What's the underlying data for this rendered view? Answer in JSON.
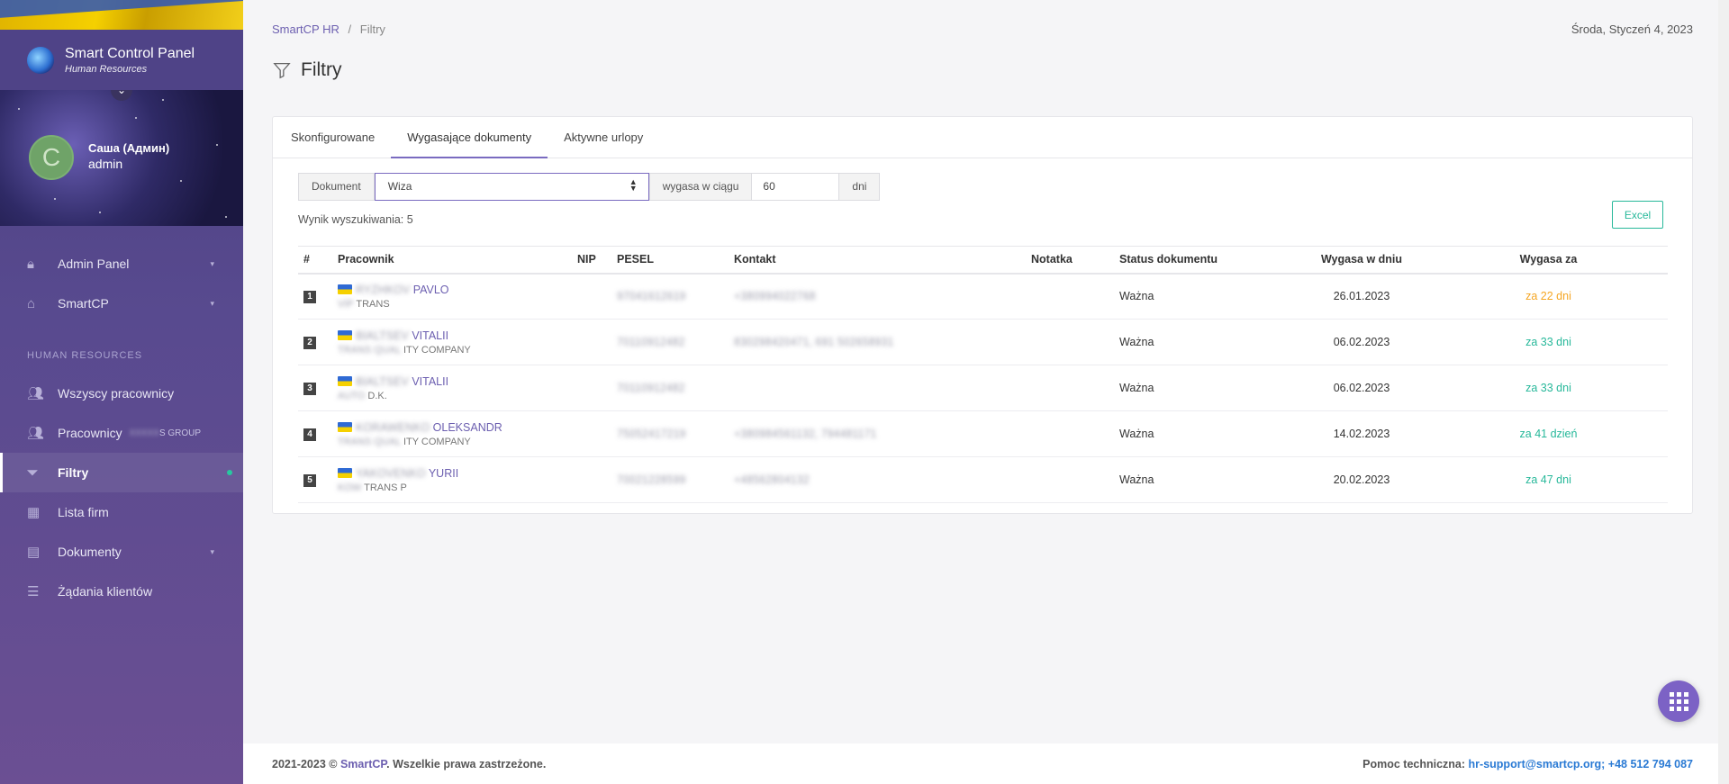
{
  "sidebar": {
    "brand_title": "Smart Control Panel",
    "brand_subtitle": "Human Resources",
    "user_initial": "С",
    "user_name": "Саша (Админ)",
    "user_role": "admin",
    "items": [
      {
        "label": "Admin Panel",
        "icon": "lock-icon",
        "has_chevron": true
      },
      {
        "label": "SmartCP",
        "icon": "home-icon",
        "has_chevron": true
      }
    ],
    "section_label": "HUMAN RESOURCES",
    "hr_items": [
      {
        "label": "Wszyscy pracownicy",
        "icon": "users-icon"
      },
      {
        "label": "Pracownicy",
        "suffix": "S GROUP",
        "icon": "users-icon"
      },
      {
        "label": "Filtry",
        "icon": "filter-icon",
        "active": true
      },
      {
        "label": "Lista firm",
        "icon": "building-icon"
      },
      {
        "label": "Dokumenty",
        "icon": "document-icon",
        "has_chevron": true
      },
      {
        "label": "Żądania klientów",
        "icon": "list-icon"
      }
    ]
  },
  "breadcrumb": {
    "root": "SmartCP HR",
    "separator": "/",
    "current": "Filtry"
  },
  "date": "Środa, Styczeń 4, 2023",
  "page_title": "Filtry",
  "tabs": [
    {
      "label": "Skonfigurowane",
      "active": false
    },
    {
      "label": "Wygasające dokumenty",
      "active": true
    },
    {
      "label": "Aktywne urlopy",
      "active": false
    }
  ],
  "filter": {
    "document_label": "Dokument",
    "document_value": "Wiza",
    "expires_label": "wygasa w ciągu",
    "days_value": "60",
    "days_unit": "dni"
  },
  "result_text": "Wynik wyszukiwania: 5",
  "excel_label": "Excel",
  "table": {
    "headers": [
      "#",
      "Pracownik",
      "NIP",
      "PESEL",
      "Kontakt",
      "Notatka",
      "Status dokumentu",
      "Wygasa w dniu",
      "Wygasa za"
    ],
    "rows": [
      {
        "n": "1",
        "name_blur": "RYZHKOV",
        "name": "PAVLO",
        "co_blur": "VIP",
        "co": "TRANS",
        "pesel": "97041612619",
        "contact": "+380994022768",
        "status": "Ważna",
        "date": "26.01.2023",
        "expires": "za 22 dni",
        "color": "#f5a623"
      },
      {
        "n": "2",
        "name_blur": "BIALTSEV",
        "name": "VITALII",
        "co_blur": "TRANS QUAL",
        "co": "ITY COMPANY",
        "pesel": "70110912482",
        "contact": "830298420471, 691 502658931",
        "status": "Ważna",
        "date": "06.02.2023",
        "expires": "za 33 dni",
        "color": "#27b89a"
      },
      {
        "n": "3",
        "name_blur": "BIALTSEV",
        "name": "VITALII",
        "co_blur": "AUTO",
        "co": "D.K.",
        "pesel": "70110912482",
        "contact": "",
        "status": "Ważna",
        "date": "06.02.2023",
        "expires": "za 33 dni",
        "color": "#27b89a"
      },
      {
        "n": "4",
        "name_blur": "KORAWENKO",
        "name": "OLEKSANDR",
        "co_blur": "TRANS QUAL",
        "co": "ITY COMPANY",
        "pesel": "75052417219",
        "contact": "+380984561132, 794481171",
        "status": "Ważna",
        "date": "14.02.2023",
        "expires": "za 41 dzień",
        "color": "#27b89a"
      },
      {
        "n": "5",
        "name_blur": "YAKOVENKO",
        "name": "YURII",
        "co_blur": "KOW",
        "co": "TRANS P",
        "pesel": "70021228599",
        "contact": "+48562804132",
        "status": "Ważna",
        "date": "20.02.2023",
        "expires": "za 47 dni",
        "color": "#27b89a"
      }
    ]
  },
  "footer": {
    "left_prefix": "2021-2023 ©",
    "brand": "SmartCP",
    "left_suffix": ". Wszelkie prawa zastrzeżone.",
    "support_label": "Pomoc techniczna:",
    "support_contact": "hr-support@smartcp.org; +48 512 794 087"
  }
}
